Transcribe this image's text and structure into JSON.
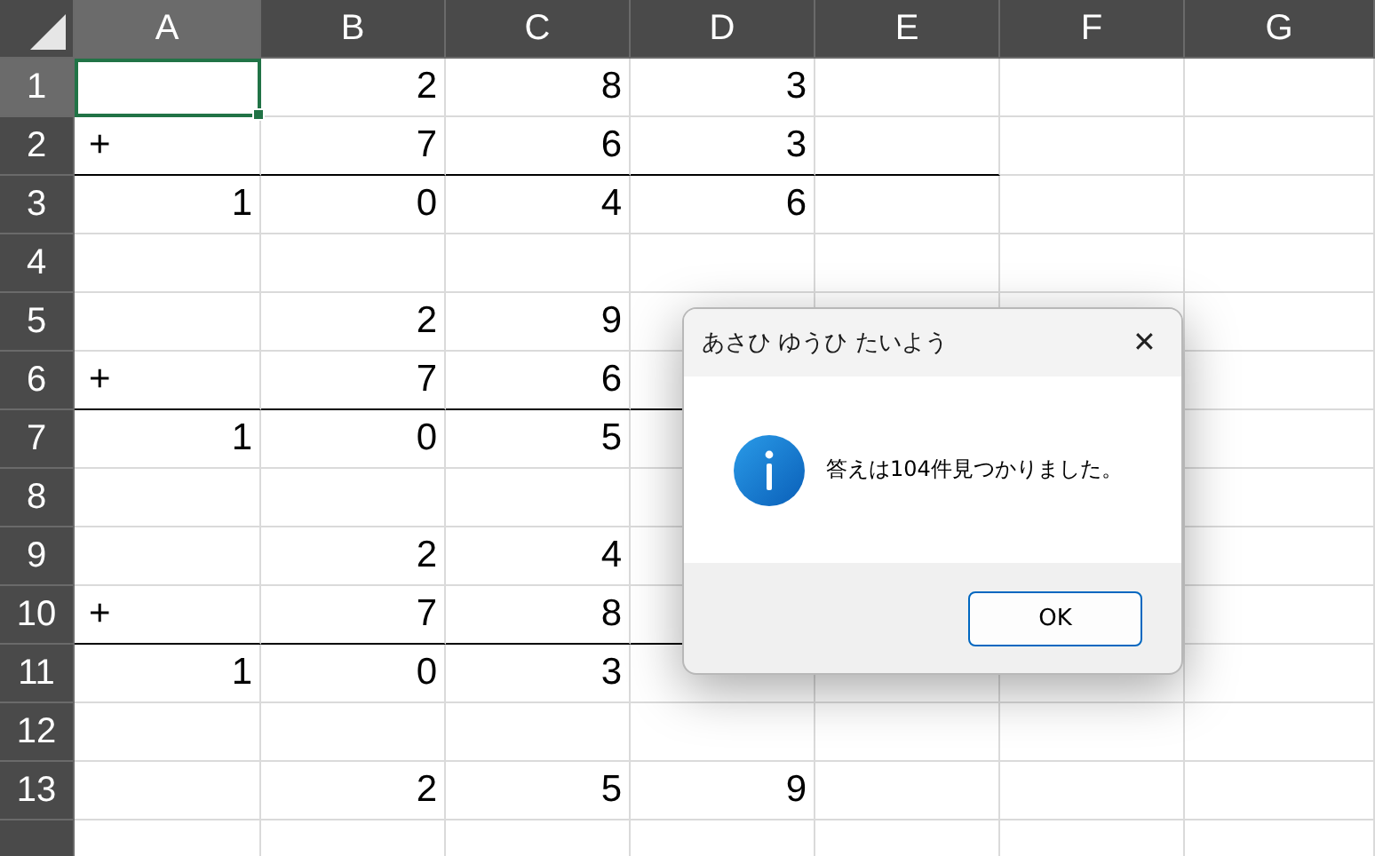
{
  "sheet": {
    "columns": [
      {
        "label": "A",
        "selected": true
      },
      {
        "label": "B",
        "selected": false
      },
      {
        "label": "C",
        "selected": false
      },
      {
        "label": "D",
        "selected": false
      },
      {
        "label": "E",
        "selected": false
      },
      {
        "label": "F",
        "selected": false
      },
      {
        "label": "G",
        "selected": false
      }
    ],
    "rows": [
      {
        "header": "1",
        "selected": true,
        "border_bottom": false,
        "cells": [
          {
            "selected": true
          },
          {
            "value": "2",
            "selected": false
          },
          {
            "value": "8",
            "selected": false
          },
          {
            "value": "3",
            "selected": false
          },
          {
            "selected": false
          },
          {
            "selected": false
          },
          {
            "selected": false
          }
        ]
      },
      {
        "header": "2",
        "selected": false,
        "border_bottom": true,
        "cells": [
          {
            "value": "+",
            "selected": false
          },
          {
            "value": "7",
            "selected": false
          },
          {
            "value": "6",
            "selected": false
          },
          {
            "value": "3",
            "selected": false
          },
          {
            "selected": false
          },
          {
            "selected": false
          },
          {
            "selected": false
          }
        ]
      },
      {
        "header": "3",
        "selected": false,
        "border_bottom": false,
        "cells": [
          {
            "value": "1",
            "selected": false
          },
          {
            "value": "0",
            "selected": false
          },
          {
            "value": "4",
            "selected": false
          },
          {
            "value": "6",
            "selected": false
          },
          {
            "selected": false
          },
          {
            "selected": false
          },
          {
            "selected": false
          }
        ]
      },
      {
        "header": "4",
        "selected": false,
        "border_bottom": false,
        "cells": [
          {
            "selected": false
          },
          {
            "selected": false
          },
          {
            "selected": false
          },
          {
            "selected": false
          },
          {
            "selected": false
          },
          {
            "selected": false
          },
          {
            "selected": false
          }
        ]
      },
      {
        "header": "5",
        "selected": false,
        "border_bottom": false,
        "cells": [
          {
            "selected": false
          },
          {
            "value": "2",
            "selected": false
          },
          {
            "value": "9",
            "selected": false
          },
          {
            "selected": false
          },
          {
            "selected": false
          },
          {
            "selected": false
          },
          {
            "selected": false
          }
        ]
      },
      {
        "header": "6",
        "selected": false,
        "border_bottom": true,
        "cells": [
          {
            "value": "+",
            "selected": false
          },
          {
            "value": "7",
            "selected": false
          },
          {
            "value": "6",
            "selected": false
          },
          {
            "selected": false
          },
          null,
          {
            "selected": false
          },
          {
            "selected": false
          }
        ]
      },
      {
        "header": "7",
        "selected": false,
        "border_bottom": false,
        "cells": [
          {
            "value": "1",
            "selected": false
          },
          {
            "value": "0",
            "selected": false
          },
          {
            "value": "5",
            "selected": false
          },
          {
            "selected": false
          },
          null,
          {
            "selected": false
          },
          {
            "selected": false
          }
        ]
      },
      {
        "header": "8",
        "selected": false,
        "border_bottom": false,
        "cells": [
          {
            "selected": false
          },
          {
            "selected": false
          },
          {
            "selected": false
          },
          {
            "selected": false
          },
          null,
          {
            "selected": false
          },
          {
            "selected": false
          }
        ]
      },
      {
        "header": "9",
        "selected": false,
        "border_bottom": false,
        "cells": [
          {
            "selected": false
          },
          {
            "value": "2",
            "selected": false
          },
          {
            "value": "4",
            "selected": false
          },
          {
            "selected": false
          },
          null,
          {
            "selected": false
          },
          {
            "selected": false
          }
        ]
      },
      {
        "header": "10",
        "selected": false,
        "border_bottom": true,
        "cells": [
          {
            "value": "+",
            "selected": false
          },
          {
            "value": "7",
            "selected": false
          },
          {
            "value": "8",
            "selected": false
          },
          {
            "selected": false
          },
          null,
          {
            "selected": false
          },
          {
            "selected": false
          }
        ]
      },
      {
        "header": "11",
        "selected": false,
        "border_bottom": false,
        "cells": [
          {
            "value": "1",
            "selected": false
          },
          {
            "value": "0",
            "selected": false
          },
          {
            "value": "3",
            "selected": false
          },
          {
            "selected": false
          },
          {
            "selected": false
          },
          {
            "selected": false
          },
          {
            "selected": false
          }
        ]
      },
      {
        "header": "12",
        "selected": false,
        "border_bottom": false,
        "cells": [
          {
            "selected": false
          },
          {
            "selected": false
          },
          {
            "selected": false
          },
          {
            "selected": false
          },
          {
            "selected": false
          },
          {
            "selected": false
          },
          {
            "selected": false
          }
        ]
      },
      {
        "header": "13",
        "selected": false,
        "border_bottom": false,
        "cells": [
          {
            "selected": false
          },
          {
            "value": "2",
            "selected": false
          },
          {
            "value": "5",
            "selected": false
          },
          {
            "value": "9",
            "selected": false
          },
          {
            "selected": false
          },
          {
            "selected": false
          },
          {
            "selected": false
          }
        ]
      },
      {
        "selected": false,
        "cells": [
          {
            "selected": false
          },
          {
            "selected": false
          },
          {
            "selected": false
          },
          {
            "selected": false
          },
          {
            "selected": false
          },
          {
            "selected": false
          },
          {
            "selected": false
          }
        ]
      }
    ]
  },
  "dialog": {
    "title": "あさひ ゆうひ たいよう",
    "close": "✕",
    "message": "答えは104件見つかりました。",
    "buttons": [
      {
        "label": "OK",
        "focused": true
      }
    ]
  }
}
